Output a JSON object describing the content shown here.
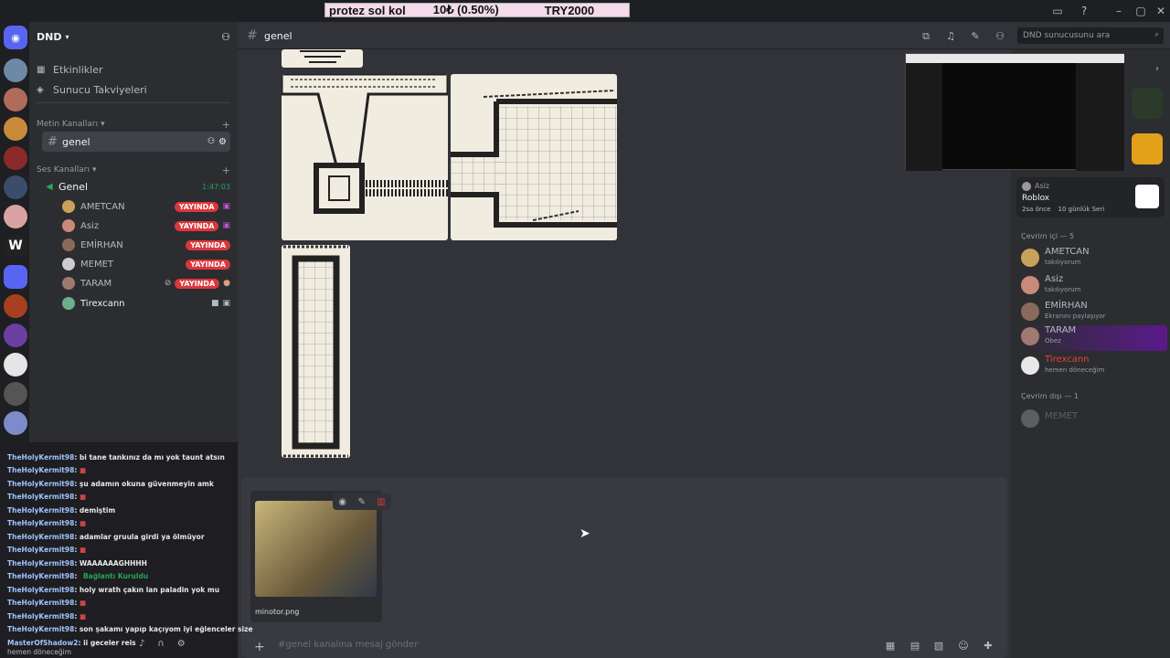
{
  "ticker": {
    "item": "protez sol kol",
    "price": "10₺ (0.50%)",
    "code": "TRY2000"
  },
  "server": {
    "name": "DND"
  },
  "sidebar": {
    "events": "Etkinlikler",
    "boosts": "Sunucu Takviyeleri",
    "text_category": "Metin Kanalları",
    "text_channel": "genel",
    "voice_category": "Ses Kanalları",
    "voice_channel": "Genel",
    "voice_timer": "1:47:03",
    "voice_users": [
      {
        "name": "AMETCAN",
        "live": "YAYINDA"
      },
      {
        "name": "Asiz",
        "live": "YAYINDA"
      },
      {
        "name": "EMİRHAN",
        "live": "YAYINDA"
      },
      {
        "name": "MEMET",
        "live": "YAYINDA"
      },
      {
        "name": "TARAM",
        "live": "YAYINDA"
      },
      {
        "name": "Tirexcann",
        "live": ""
      }
    ]
  },
  "header": {
    "channel": "genel",
    "search_placeholder": "DND sunucusunu ara"
  },
  "activity": {
    "user": "Asiz",
    "game": "Roblox",
    "time": "2sa önce",
    "streak": "10 günlük Seri"
  },
  "members": {
    "online_header": "Çevrim içi — 5",
    "online": [
      {
        "name": "AMETCAN",
        "status": "takılıyorum",
        "color": "#b5bac1"
      },
      {
        "name": "Asiz",
        "status": "takılıyorum",
        "color": "#b5bac1"
      },
      {
        "name": "EMİRHAN",
        "status": "Ekranını paylaşıyor",
        "color": "#b5bac1"
      },
      {
        "name": "TARAM",
        "status": "Obez",
        "color": "#b5bac1"
      },
      {
        "name": "Tirexcann",
        "status": "hemen döneceğim",
        "color": "#e8413e"
      }
    ],
    "offline_header": "Çevrim dışı — 1",
    "offline": [
      {
        "name": "MEMET"
      }
    ]
  },
  "chat": [
    {
      "user": "TheHolyKermit98",
      "msg": ": bi tane tankınız da mı yok taunt atsın"
    },
    {
      "user": "TheHolyKermit98",
      "msg": ": "
    },
    {
      "user": "TheHolyKermit98",
      "msg": ": şu adamın okuna güvenmeyin amk"
    },
    {
      "user": "TheHolyKermit98",
      "msg": ": "
    },
    {
      "user": "TheHolyKermit98",
      "msg": ": demiştim"
    },
    {
      "user": "TheHolyKermit98",
      "msg": ": "
    },
    {
      "user": "TheHolyKermit98",
      "msg": ": adamlar gruula girdi ya ölmüyor"
    },
    {
      "user": "TheHolyKermit98",
      "msg": ": "
    },
    {
      "user": "TheHolyKermit98",
      "msg": ": WAAAAAAGHHHH"
    },
    {
      "user": "TheHolyKermit98",
      "msg": ": "
    },
    {
      "user": "TheHolyKermit98",
      "msg": ": holy wrath çakın lan paladin yok mu"
    },
    {
      "user": "TheHolyKermit98",
      "msg": ": "
    },
    {
      "user": "TheHolyKermit98",
      "msg": ": "
    },
    {
      "user": "TheHolyKermit98",
      "msg": ": son şakamı yapıp kaçıyom iyi eğlenceler size"
    },
    {
      "user": "MasterOfShadow2",
      "msg": ": ii geceler reis"
    }
  ],
  "connection": "Bağlantı Kuruldu",
  "bottom_status": "hemen döneceğim",
  "attachment": {
    "filename": "minotor.png"
  },
  "composer": {
    "placeholder": "#genel kanalına mesaj gönder"
  }
}
